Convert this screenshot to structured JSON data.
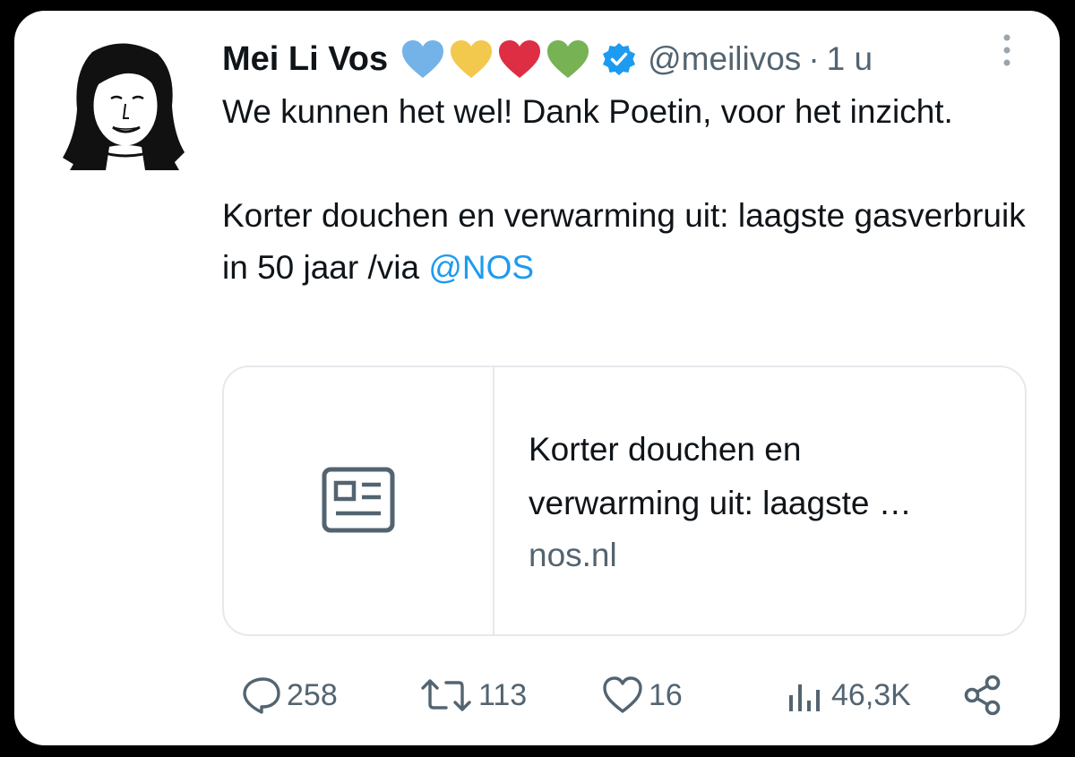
{
  "tweet": {
    "author_name": "Mei Li Vos",
    "handle": "@meilivos",
    "separator": "·",
    "time": "1 u",
    "emoji": [
      "blue-heart",
      "yellow-heart",
      "red-heart",
      "green-heart"
    ],
    "text_line_1": "We kunnen het wel! Dank Poetin, voor het inzicht.",
    "text_line_2": "Korter douchen en verwarming uit: laagste gasverbruik in 50 jaar /via ",
    "mention": "@NOS"
  },
  "link_card": {
    "title_line_1": "Korter douchen en",
    "title_line_2": "verwarming uit: laagste …",
    "domain": "nos.nl"
  },
  "actions": {
    "replies": "258",
    "retweets": "113",
    "likes": "16",
    "views": "46,3K"
  },
  "colors": {
    "heart_blue": "#74b3e7",
    "heart_yellow": "#f2c94c",
    "heart_red": "#dd2e44",
    "heart_green": "#77b255",
    "verified": "#1d9bf0",
    "mention": "#1d9bf0",
    "secondary_text": "#536471"
  }
}
